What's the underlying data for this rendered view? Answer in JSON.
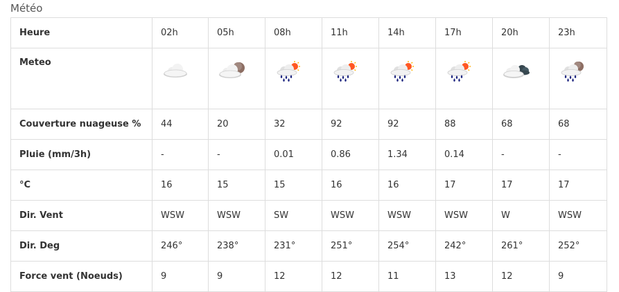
{
  "section_title": "Météo",
  "hours": [
    "02h",
    "05h",
    "08h",
    "11h",
    "14h",
    "17h",
    "20h",
    "23h"
  ],
  "rows": {
    "heure_label": "Heure",
    "meteo_label": "Meteo",
    "meteo_icons": [
      "cloud-icon",
      "cloud-moon-icon",
      "rain-sun-icon",
      "rain-sun-icon",
      "rain-sun-icon",
      "rain-sun-icon",
      "dark-cloud-icon",
      "rain-moon-icon"
    ],
    "couverture_label": "Couverture nuageuse %",
    "couverture": [
      "44",
      "20",
      "32",
      "92",
      "92",
      "88",
      "68",
      "68"
    ],
    "pluie_label": "Pluie (mm/3h)",
    "pluie": [
      "-",
      "-",
      "0.01",
      "0.86",
      "1.34",
      "0.14",
      "-",
      "-"
    ],
    "temp_label": "°C",
    "temp": [
      "16",
      "15",
      "15",
      "16",
      "16",
      "17",
      "17",
      "17"
    ],
    "dir_vent_label": "Dir. Vent",
    "dir_vent": [
      "WSW",
      "WSW",
      "SW",
      "WSW",
      "WSW",
      "WSW",
      "W",
      "WSW"
    ],
    "dir_deg_label": "Dir. Deg",
    "dir_deg": [
      "246°",
      "238°",
      "231°",
      "251°",
      "254°",
      "242°",
      "261°",
      "252°"
    ],
    "force_label": "Force vent (Noeuds)",
    "force": [
      "9",
      "9",
      "12",
      "12",
      "11",
      "13",
      "12",
      "9"
    ]
  },
  "colors": {
    "border": "#dddddd",
    "text": "#333333",
    "rain_drop": "#1a237e",
    "sun": "#ff5722",
    "moon": "#8d6e63",
    "dark_cloud": "#37474f"
  }
}
